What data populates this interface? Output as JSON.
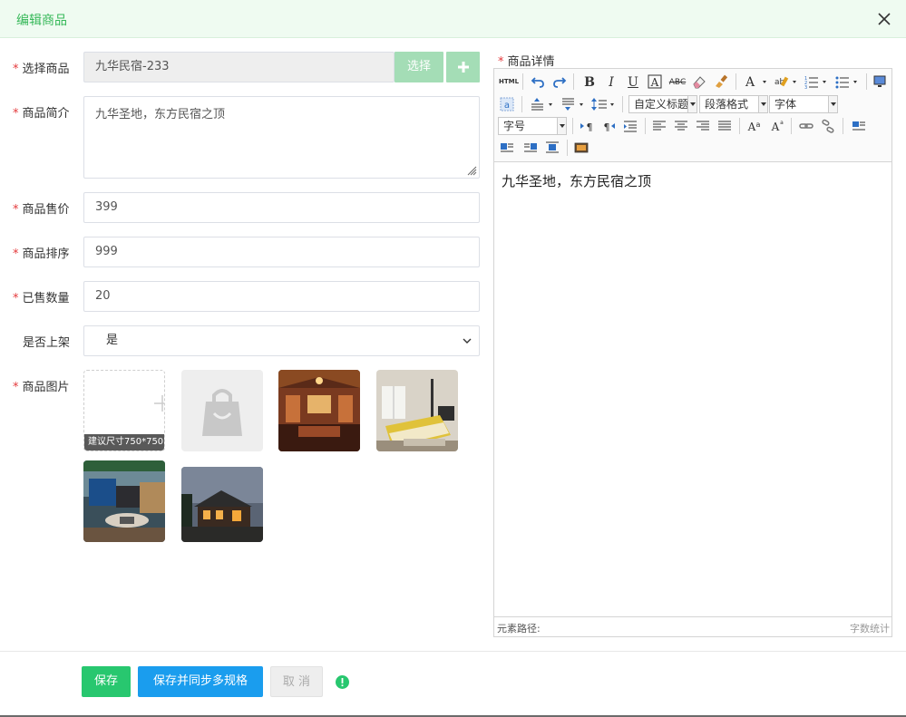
{
  "dialog": {
    "title": "编辑商品"
  },
  "form": {
    "product": {
      "label": "选择商品",
      "value": "九华民宿-233",
      "select_button": "选择",
      "add_button": "+"
    },
    "intro": {
      "label": "商品简介",
      "value": "九华圣地，东方民宿之顶"
    },
    "price": {
      "label": "商品售价",
      "value": "399"
    },
    "sort": {
      "label": "商品排序",
      "value": "999"
    },
    "sold": {
      "label": "已售数量",
      "value": "20"
    },
    "on_shelf": {
      "label": "是否上架",
      "value": "是"
    },
    "images": {
      "label": "商品图片",
      "upload_hint": "建议尺寸750*750"
    }
  },
  "editor": {
    "label": "商品详情",
    "html_button": "HTML",
    "combo_title": "自定义标题",
    "combo_paragraph": "段落格式",
    "combo_font": "字体",
    "combo_size": "字号",
    "content": "九华圣地，东方民宿之顶",
    "path_label": "元素路径:",
    "word_count": "字数统计"
  },
  "footer": {
    "save": "保存",
    "save_sync": "保存并同步多规格",
    "cancel": "取 消"
  },
  "colors": {
    "accent_green": "#36b859",
    "save_green": "#28c76f",
    "blue": "#1a9dee",
    "required_red": "#e4393c",
    "light_green_btn": "#a4ddb6"
  }
}
